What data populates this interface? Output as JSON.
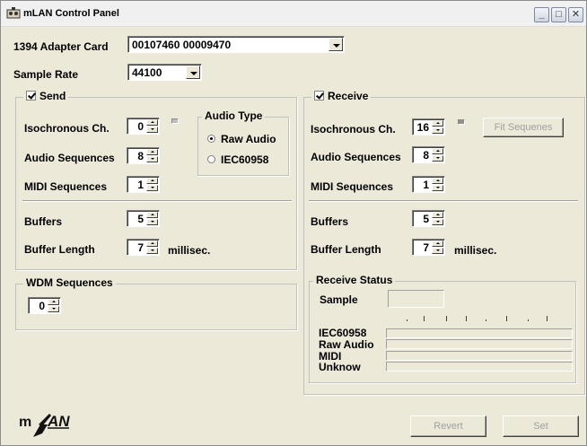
{
  "window": {
    "title": "mLAN Control Panel"
  },
  "adapter": {
    "label": "1394 Adapter Card",
    "value": "00107460 00009470"
  },
  "sample_rate": {
    "label": "Sample Rate",
    "value": "44100"
  },
  "send": {
    "title": "Send",
    "checked": true,
    "iso_label": "Isochronous Ch.",
    "iso_value": "0",
    "audio_seq_label": "Audio Sequences",
    "audio_seq_value": "8",
    "midi_seq_label": "MIDI Sequences",
    "midi_seq_value": "1",
    "buffers_label": "Buffers",
    "buffers_value": "5",
    "buffer_len_label": "Buffer Length",
    "buffer_len_value": "7",
    "buffer_unit": "millisec.",
    "audio_type": {
      "title": "Audio Type",
      "options": [
        "Raw Audio",
        "IEC60958"
      ],
      "selected": "Raw Audio"
    }
  },
  "wdm": {
    "title": "WDM Sequences",
    "value": "0"
  },
  "receive": {
    "title": "Receive",
    "checked": true,
    "iso_label": "Isochronous Ch.",
    "iso_value": "16",
    "fit_button": "Fit Sequenes",
    "audio_seq_label": "Audio Sequences",
    "audio_seq_value": "8",
    "midi_seq_label": "MIDI Sequences",
    "midi_seq_value": "1",
    "buffers_label": "Buffers",
    "buffers_value": "5",
    "buffer_len_label": "Buffer Length",
    "buffer_len_value": "7",
    "buffer_unit": "millisec."
  },
  "receive_status": {
    "title": "Receive Status",
    "sample_label": "Sample",
    "sample_value": "",
    "rows": [
      "IEC60958",
      "Raw Audio",
      "MIDI",
      "Unknow"
    ]
  },
  "footer": {
    "logo_text": "mLAN",
    "revert": "Revert",
    "set": "Set"
  },
  "icons": [
    "app-icon",
    "minimize-icon",
    "maximize-icon",
    "close-icon"
  ]
}
